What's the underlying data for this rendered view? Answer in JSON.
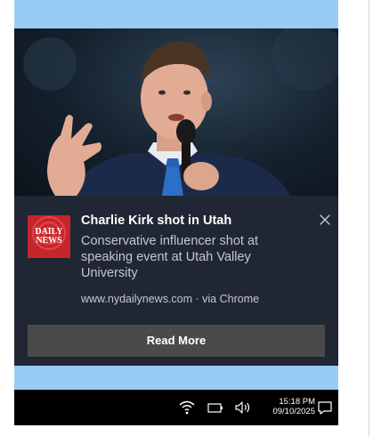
{
  "notification": {
    "source_logo": [
      "DAILY",
      "NEWS"
    ],
    "title": "Charlie Kirk shot in Utah",
    "body": "Conservative influencer shot at speaking event at Utah Valley University",
    "attribution": "www.nydailynews.com · via Chrome",
    "action_label": "Read More",
    "close_icon": "close-icon"
  },
  "taskbar": {
    "icons": [
      "wifi-icon",
      "battery-icon",
      "volume-icon",
      "notification-icon"
    ],
    "time": "15:18 PM",
    "date": "09/10/2025"
  },
  "colors": {
    "toast_bg": "#202633",
    "button_bg": "#4a4a4a",
    "desktop_blue": "#99ccf4",
    "brand_red": "#c6262a"
  }
}
